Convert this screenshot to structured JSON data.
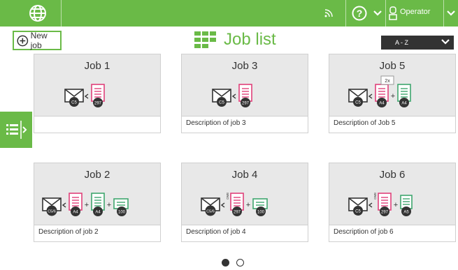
{
  "header": {
    "brand_icon": "globe-logo-icon",
    "operator_label": "Operator",
    "icons": [
      "wifi-signal-icon",
      "help-icon",
      "chevron-down-icon",
      "user-icon",
      "chevron-down-icon"
    ]
  },
  "toolbar": {
    "new_job_label": "New job"
  },
  "page": {
    "title": "Job list"
  },
  "sort": {
    "value": "A - Z"
  },
  "colors": {
    "accent": "#6aba47",
    "letter_pink": "#e0407a",
    "letter_green": "#3fa66e",
    "dark": "#333333"
  },
  "jobs": [
    {
      "name": "Job 1",
      "description": ""
    },
    {
      "name": "Job 3",
      "description": "Description of job 3"
    },
    {
      "name": "Job 5",
      "description": "Description of Job 5"
    },
    {
      "name": "Job 2",
      "description": "Description of job 2"
    },
    {
      "name": "Job 4",
      "description": "Description of job 4"
    },
    {
      "name": "Job 6",
      "description": "Description of job 6"
    }
  ],
  "icon_labels": {
    "c5": "C5",
    "c56": "C5/6",
    "a4": "A4",
    "a5": "A5",
    "n297": "297",
    "n100": "100",
    "multiplier": "2x",
    "side_text": "OME"
  },
  "pagination": {
    "pages": 2,
    "current": 1
  }
}
